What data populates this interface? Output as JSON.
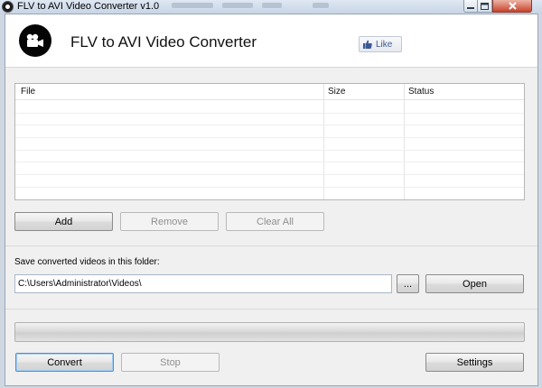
{
  "window": {
    "title": "FLV to AVI Video Converter v1.0"
  },
  "header": {
    "app_title": "FLV to AVI Video Converter",
    "logo_icon": "video-camera-icon",
    "like_label": "Like",
    "like_icon": "thumbs-up-icon"
  },
  "table": {
    "columns": [
      "File",
      "Size",
      "Status"
    ],
    "rows": []
  },
  "actions": {
    "add_label": "Add",
    "remove_label": "Remove",
    "clear_all_label": "Clear All"
  },
  "output": {
    "save_label": "Save converted videos in this folder:",
    "path": "C:\\Users\\Administrator\\Videos\\",
    "browse_label": "...",
    "open_label": "Open"
  },
  "progress": {
    "value": 0
  },
  "bottom": {
    "convert_label": "Convert",
    "stop_label": "Stop",
    "settings_label": "Settings"
  },
  "colors": {
    "progress_fill": "#5fbe50",
    "focus_border": "#4e8fd0",
    "like_text": "#3b5998"
  }
}
